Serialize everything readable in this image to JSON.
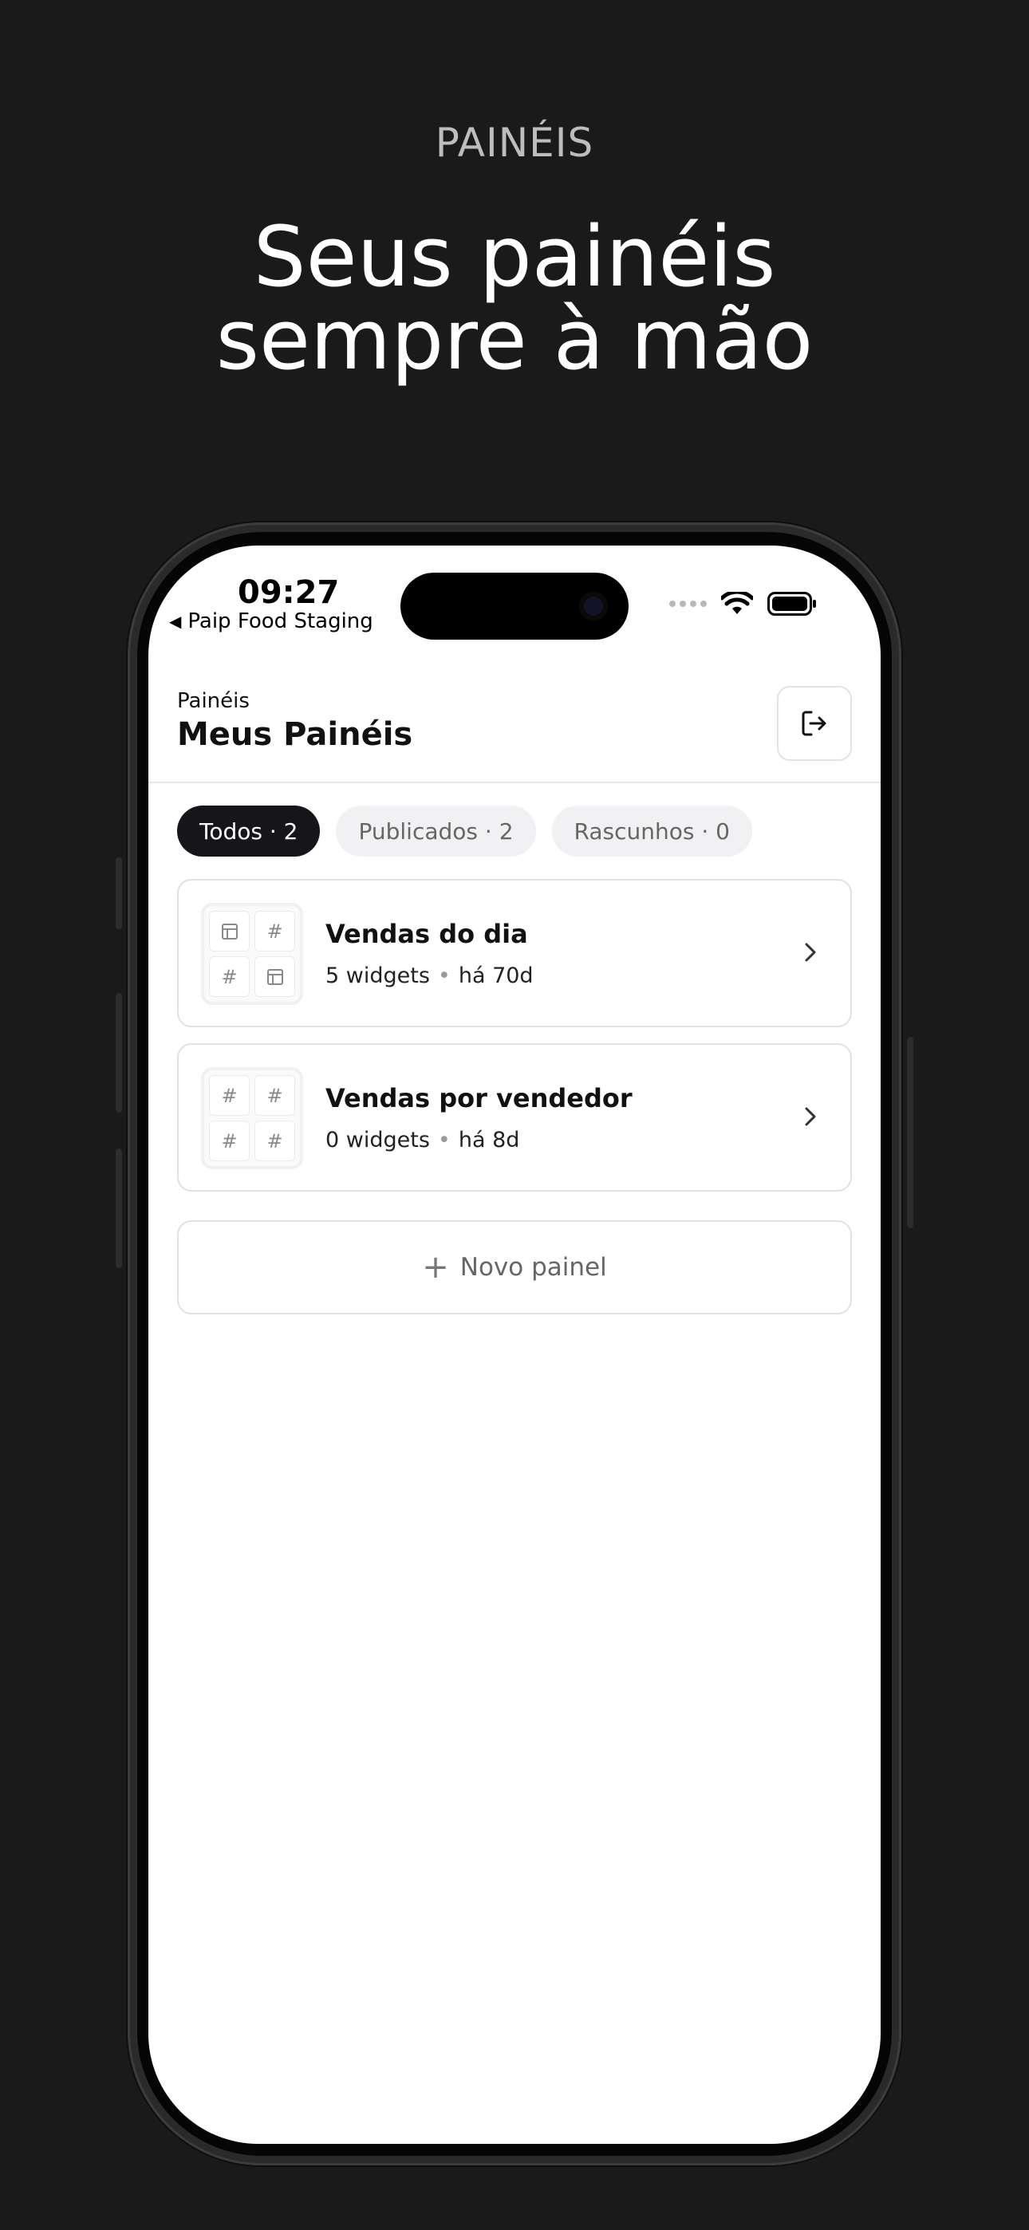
{
  "hero": {
    "eyebrow": "PAINÉIS",
    "title_line1": "Seus painéis",
    "title_line2": "sempre à mão"
  },
  "status_bar": {
    "time": "09:27",
    "back_label": "Paip Food Staging"
  },
  "header": {
    "eyebrow": "Painéis",
    "title": "Meus Painéis"
  },
  "tabs": [
    {
      "label": "Todos · 2",
      "active": true
    },
    {
      "label": "Publicados · 2",
      "active": false
    },
    {
      "label": "Rascunhos · 0",
      "active": false
    }
  ],
  "dashboards": [
    {
      "title": "Vendas do dia",
      "widgets": "5 widgets",
      "age": "há 70d",
      "thumb": [
        "table-icon",
        "hash-icon",
        "hash-icon",
        "table-icon"
      ]
    },
    {
      "title": "Vendas por vendedor",
      "widgets": "0 widgets",
      "age": "há 8d",
      "thumb": [
        "hash-icon",
        "hash-icon",
        "hash-icon",
        "hash-icon"
      ]
    }
  ],
  "meta_separator": "•",
  "new_button": {
    "label": "Novo painel"
  },
  "colors": {
    "background": "#1a1a1a",
    "chip_active": "#16161a",
    "chip_inactive": "#f1f1f3"
  }
}
